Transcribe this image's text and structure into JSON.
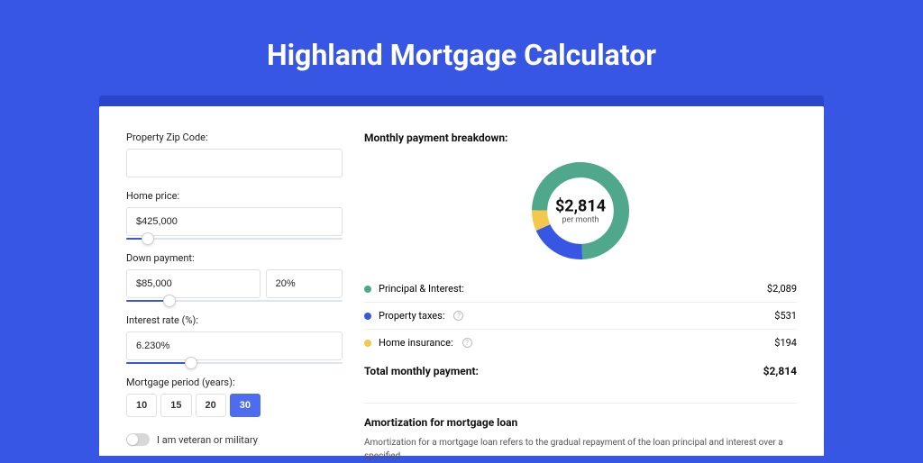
{
  "title": "Highland Mortgage Calculator",
  "form": {
    "zip_label": "Property Zip Code:",
    "zip_value": "",
    "price_label": "Home price:",
    "price_value": "$425,000",
    "price_slider_pct": "10%",
    "down_label": "Down payment:",
    "down_amount": "$85,000",
    "down_pct": "20%",
    "down_slider_pct": "20%",
    "rate_label": "Interest rate (%):",
    "rate_value": "6.230%",
    "rate_slider_pct": "30%",
    "period_label": "Mortgage period (years):",
    "period_options": [
      "10",
      "15",
      "20",
      "30"
    ],
    "period_selected": "30",
    "veteran_label": "I am veteran or military"
  },
  "breakdown": {
    "title": "Monthly payment breakdown:",
    "total_amount": "$2,814",
    "per_month": "per month",
    "items": [
      {
        "label": "Principal & Interest:",
        "value": "$2,089",
        "color": "#4fa88b",
        "help": false
      },
      {
        "label": "Property taxes:",
        "value": "$531",
        "color": "#3756e4",
        "help": true
      },
      {
        "label": "Home insurance:",
        "value": "$194",
        "color": "#f2c94c",
        "help": true
      }
    ],
    "total_label": "Total monthly payment:",
    "total_value": "$2,814"
  },
  "chart_data": {
    "type": "pie",
    "title": "Monthly payment breakdown",
    "series": [
      {
        "name": "Principal & Interest",
        "value": 2089,
        "color": "#4fa88b"
      },
      {
        "name": "Property taxes",
        "value": 531,
        "color": "#3756e4"
      },
      {
        "name": "Home insurance",
        "value": 194,
        "color": "#f2c94c"
      }
    ],
    "center_label": "$2,814",
    "center_sub": "per month"
  },
  "amortization": {
    "title": "Amortization for mortgage loan",
    "text": "Amortization for a mortgage loan refers to the gradual repayment of the loan principal and interest over a specified"
  }
}
